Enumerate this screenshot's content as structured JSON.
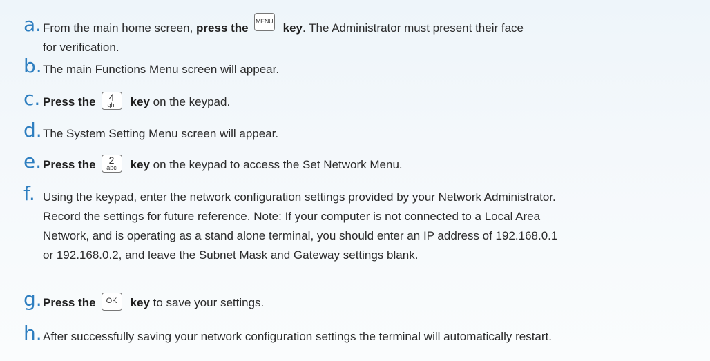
{
  "steps": [
    {
      "letter": "a.",
      "pre": "From the main home screen, ",
      "bold_a": "press the",
      "key": "MENU",
      "bold_b": "key",
      "post_line1": ". The Administrator must present their face",
      "post_line2": "for verification."
    },
    {
      "letter": "b.",
      "text": "The main Functions Menu screen will appear."
    },
    {
      "letter": "c.",
      "bold_a": "Press the",
      "key_main": "4",
      "key_sub": "ghi",
      "bold_b": "key",
      "post": " on the keypad."
    },
    {
      "letter": "d.",
      "text": "The System Setting Menu screen will appear."
    },
    {
      "letter": "e.",
      "bold_a": "Press the",
      "key_main": "2",
      "key_sub": "abc",
      "bold_b": "key",
      "post": "  on the keypad to access the Set Network Menu."
    },
    {
      "letter": "f.",
      "lines": [
        "Using the keypad, enter the network configuration settings provided by your Network Administrator.",
        "Record the settings for future reference. Note: If your computer is not connected to a Local Area",
        "Network, and is operating as a stand alone terminal, you should enter an IP address of 192.168.0.1",
        "or 192.168.0.2, and leave the Subnet Mask and Gateway settings blank."
      ]
    },
    {
      "letter": "g.",
      "bold_a": "Press the",
      "key": "OK",
      "bold_b": "key",
      "post": " to save your settings."
    },
    {
      "letter": "h.",
      "text": "After successfully saving your network configuration settings the terminal will automatically restart."
    }
  ]
}
